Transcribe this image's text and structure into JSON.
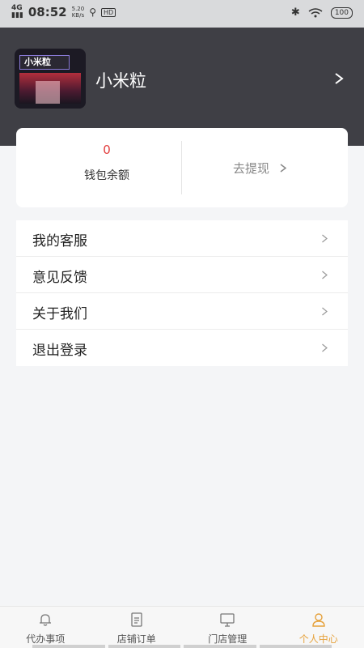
{
  "status_bar": {
    "network": "4G",
    "time": "08:52",
    "speed_value": "5.20",
    "speed_unit": "KB/s",
    "hd_badge": "HD",
    "battery": "100",
    "icons": [
      "signal-icon",
      "usb-icon",
      "bluetooth-icon",
      "wifi-icon",
      "battery-icon"
    ]
  },
  "profile": {
    "avatar_sign_text": "小米粒",
    "name": "小米粒"
  },
  "wallet": {
    "balance_value": "0",
    "balance_label": "钱包余额",
    "withdraw_label": "去提现"
  },
  "menu": {
    "items": [
      {
        "label": "我的客服"
      },
      {
        "label": "意见反馈"
      },
      {
        "label": "关于我们"
      },
      {
        "label": "退出登录"
      }
    ]
  },
  "tabbar": {
    "tabs": [
      {
        "label": "代办事项",
        "icon": "bell-icon"
      },
      {
        "label": "店铺订单",
        "icon": "document-icon"
      },
      {
        "label": "门店管理",
        "icon": "monitor-icon"
      },
      {
        "label": "个人中心",
        "icon": "person-icon"
      }
    ],
    "active_index": 3
  },
  "colors": {
    "header_bg": "#3f3f45",
    "accent": "#e6a23c",
    "balance": "#e23d3d"
  }
}
